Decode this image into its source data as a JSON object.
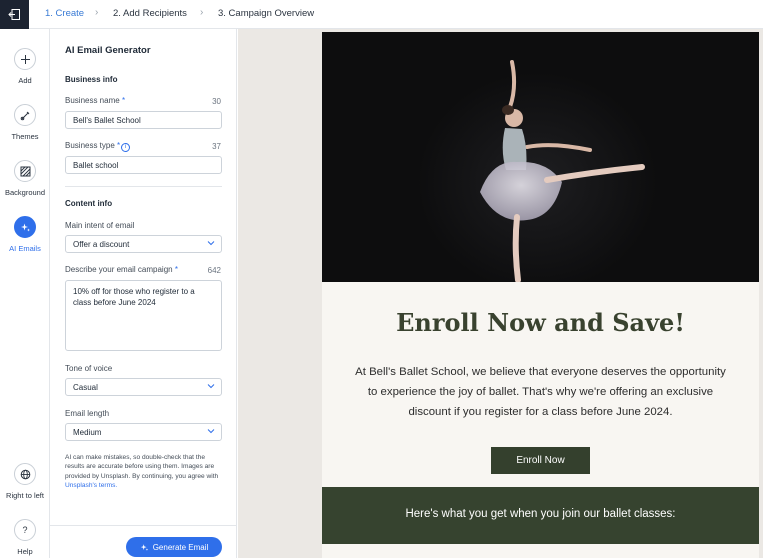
{
  "topbar": {
    "steps": [
      {
        "label": "1. Create"
      },
      {
        "label": "2. Add Recipients"
      },
      {
        "label": "3. Campaign Overview"
      }
    ]
  },
  "rail": {
    "items": [
      {
        "label": "Add",
        "icon": "plus-icon"
      },
      {
        "label": "Themes",
        "icon": "brush-icon"
      },
      {
        "label": "Background",
        "icon": "hatch-icon"
      },
      {
        "label": "AI Emails",
        "icon": "sparkle-icon"
      },
      {
        "label": "Right to left",
        "icon": "globe-icon"
      },
      {
        "label": "Help",
        "icon": "question-icon"
      }
    ]
  },
  "panel": {
    "title": "AI Email Generator",
    "business_info": "Business info",
    "business_name": {
      "label": "Business name",
      "count": "30",
      "value": "Bell's Ballet School"
    },
    "business_type": {
      "label": "Business type",
      "count": "37",
      "value": "Ballet school"
    },
    "content_info": "Content info",
    "intent": {
      "label": "Main intent of email",
      "value": "Offer a discount"
    },
    "describe": {
      "label": "Describe your email campaign",
      "count": "642",
      "value": "10% off for those who register to a class before June 2024"
    },
    "tone": {
      "label": "Tone of voice",
      "value": "Casual"
    },
    "length": {
      "label": "Email length",
      "value": "Medium"
    },
    "disclaimer": "AI can make mistakes, so double-check that the results are accurate before using them. Images are provided by Unsplash. By continuing, you agree with ",
    "disclaimer_link": "Unsplash's terms.",
    "generate_label": "Generate Email"
  },
  "email": {
    "headline": "Enroll Now and Save!",
    "body": "At Bell's Ballet School, we believe that everyone deserves the opportunity to experience the joy of ballet. That's why we're offering an exclusive discount if you register for a class before June 2024.",
    "cta": "Enroll Now",
    "band_text": "Here's what you get when you join our ballet classes:"
  },
  "colors": {
    "accent": "#2f6fea",
    "email_green": "#36432f"
  }
}
